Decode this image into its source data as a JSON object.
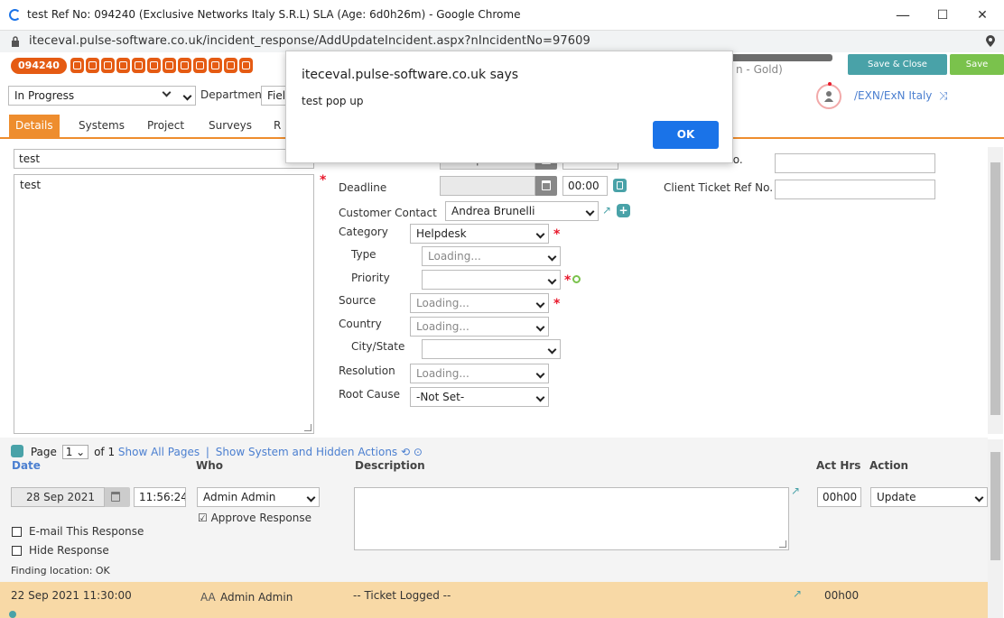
{
  "window": {
    "title": "test Ref No: 094240 (Exclusive Networks Italy S.R.L) SLA (Age: 6d0h26m) - Google Chrome",
    "url": "iteceval.pulse-software.co.uk/incident_response/AddUpdateIncident.aspx?nIncidentNo=97609",
    "controls": {
      "minimize": "—",
      "maximize": "☐",
      "close": "✕"
    }
  },
  "toolbar": {
    "ticket_number": "094240",
    "icon_names": [
      "envelope-icon",
      "phone-icon",
      "print-icon",
      "person-icon",
      "copy-icon",
      "upload-icon",
      "clock-icon",
      "location-icon",
      "link-icon",
      "refresh-icon",
      "bell-icon"
    ],
    "sla_text": "n - Gold)",
    "save_close_label": "Save & Close",
    "save_label": "Save"
  },
  "header": {
    "status": "In Progress",
    "department_label": "Department",
    "department_value": "Fiel",
    "company_path": "/EXN/ExN Italy"
  },
  "tabs": [
    {
      "label": "Details",
      "active": true
    },
    {
      "label": "Systems"
    },
    {
      "label": "Project"
    },
    {
      "label": "Surveys"
    },
    {
      "label": "R"
    }
  ],
  "form": {
    "subject": "test",
    "description": "test",
    "date_partial": "22 Sep 2021",
    "deadline_label": "Deadline",
    "deadline_time": "00:00",
    "further_po_label": "Further PO No.",
    "client_ticket_label": "Client Ticket Ref No.",
    "customer_contact_label": "Customer Contact",
    "customer_contact_value": "Andrea Brunelli",
    "category_label": "Category",
    "category_value": "Helpdesk",
    "type_label": "Type",
    "type_value": "Loading...",
    "priority_label": "Priority",
    "priority_value": "",
    "source_label": "Source",
    "source_value": "Loading...",
    "country_label": "Country",
    "country_value": "Loading...",
    "city_label": "City/State",
    "city_value": "",
    "resolution_label": "Resolution",
    "resolution_value": "Loading...",
    "root_cause_label": "Root Cause",
    "root_cause_value": "-Not Set-"
  },
  "actions": {
    "page_label": "Page",
    "page_value": "1",
    "page_of": "of 1",
    "show_all_pages": "Show All Pages",
    "separator": "|",
    "show_system_hidden": "Show System and Hidden Actions",
    "columns": {
      "date": "Date",
      "who": "Who",
      "description": "Description",
      "act_hrs": "Act Hrs",
      "action": "Action"
    },
    "new_entry": {
      "date": "28 Sep 2021",
      "time": "11:56:24",
      "who": "Admin Admin",
      "approve_response": "Approve Response",
      "email_response": "E-mail This Response",
      "hide_response": "Hide Response",
      "finding_location": "Finding location: OK",
      "act_hrs": "00h00",
      "action": "Update"
    },
    "logged_entry": {
      "datetime": "22 Sep 2021 11:30:00",
      "initials": "AA",
      "who": "Admin Admin",
      "description": "-- Ticket Logged --",
      "act_hrs": "00h00"
    }
  },
  "dialog": {
    "title": "iteceval.pulse-software.co.uk says",
    "message": "test pop up",
    "ok_label": "OK"
  },
  "colors": {
    "brand_orange": "#e55b13",
    "tab_orange": "#ee8d2e",
    "teal": "#49a2a8",
    "green": "#7ac24c",
    "link_blue": "#4b7fd0",
    "logged_row": "#f8d9a6",
    "dialog_button": "#1a73e8"
  }
}
